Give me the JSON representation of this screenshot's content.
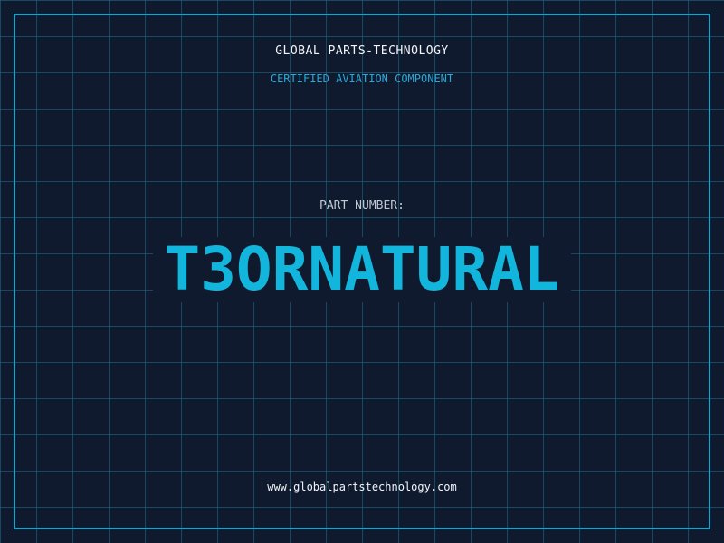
{
  "header": {
    "company": "GLOBAL PARTS-TECHNOLOGY",
    "subtitle": "CERTIFIED AVIATION COMPONENT"
  },
  "part": {
    "label": "PART NUMBER:",
    "number": "T3ORNATURAL"
  },
  "footer": {
    "website": "www.globalpartstechnology.com"
  },
  "colors": {
    "background": "#101a2e",
    "grid": "#1e6e8c",
    "frame": "#1aa3c9",
    "accent": "#12b5dc",
    "text": "#f1f5f9"
  }
}
